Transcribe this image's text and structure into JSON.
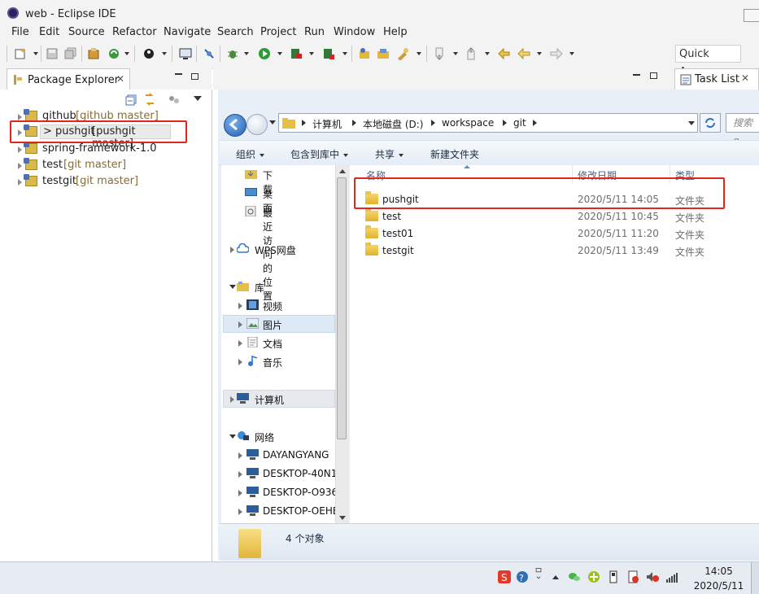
{
  "window": {
    "title": "web - Eclipse IDE"
  },
  "menu": [
    "File",
    "Edit",
    "Source",
    "Refactor",
    "Navigate",
    "Search",
    "Project",
    "Run",
    "Window",
    "Help"
  ],
  "toolbar": {
    "quick_access": "Quick Access"
  },
  "package_explorer": {
    "tab_title": "Package Explorer",
    "projects": [
      {
        "name": "github",
        "decoration": "[github master]"
      },
      {
        "name": "> pushgit",
        "decoration": "[pushgit master]"
      },
      {
        "name": "spring-framework-1.0",
        "decoration": ""
      },
      {
        "name": "test",
        "decoration": "[git master]"
      },
      {
        "name": "testgit",
        "decoration": "[git master]"
      }
    ]
  },
  "task_list": {
    "tab_title": "Task List"
  },
  "explorer": {
    "breadcrumb": [
      "计算机",
      "本地磁盘 (D:)",
      "workspace",
      "git"
    ],
    "search_placeholder": "搜索 g",
    "commands": [
      "组织",
      "包含到库中",
      "共享",
      "新建文件夹"
    ],
    "nav": {
      "favorites": [
        "下载",
        "桌面",
        "最近访问的位置"
      ],
      "wps": "WPS网盘",
      "library": "库",
      "library_items": [
        "视频",
        "图片",
        "文档",
        "音乐"
      ],
      "computer": "计算机",
      "network": "网络",
      "network_items": [
        "DAYANGYANG",
        "DESKTOP-40N1",
        "DESKTOP-O936",
        "DESKTOP-OEHE"
      ]
    },
    "columns": {
      "name": "名称",
      "date": "修改日期",
      "type": "类型"
    },
    "files": [
      {
        "name": "pushgit",
        "date": "2020/5/11 14:05",
        "type": "文件夹"
      },
      {
        "name": "test",
        "date": "2020/5/11 10:45",
        "type": "文件夹"
      },
      {
        "name": "test01",
        "date": "2020/5/11 11:20",
        "type": "文件夹"
      },
      {
        "name": "testgit",
        "date": "2020/5/11 13:49",
        "type": "文件夹"
      }
    ],
    "status": "4 个对象"
  },
  "taskbar": {
    "time": "14:05",
    "date": "2020/5/11"
  }
}
